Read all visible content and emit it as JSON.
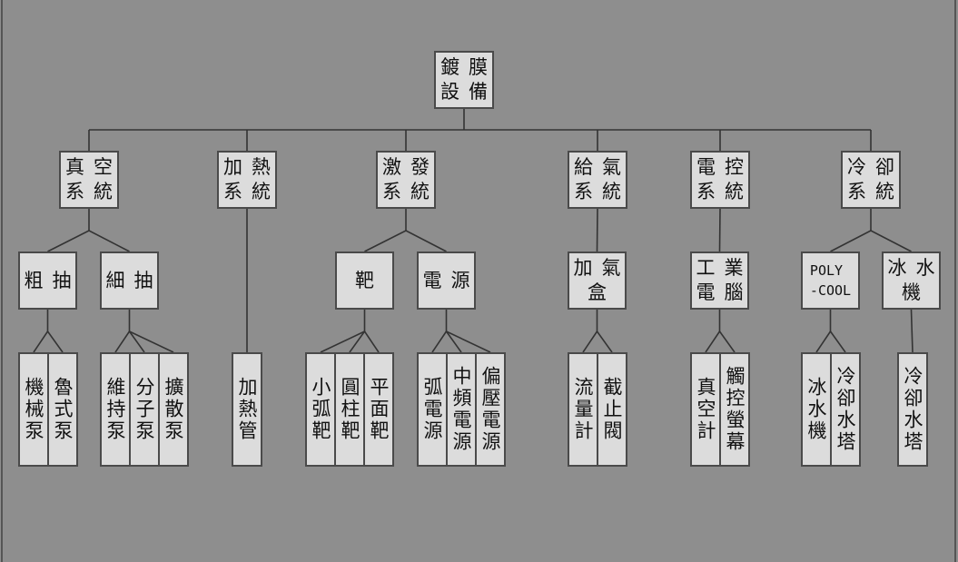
{
  "diagram": {
    "type": "tree",
    "root": {
      "label": "鍍膜設備",
      "rows": [
        "鍍膜",
        "設備"
      ],
      "children": [
        {
          "label": "真空系統",
          "rows": [
            "真空",
            "系統"
          ],
          "children": [
            {
              "label": "粗抽",
              "rows": [
                "粗抽"
              ],
              "leaves": [
                "機械泵",
                "魯式泵"
              ]
            },
            {
              "label": "細抽",
              "rows": [
                "細抽"
              ],
              "leaves": [
                "維持泵",
                "分子泵",
                "擴散泵"
              ]
            }
          ]
        },
        {
          "label": "加熱系統",
          "rows": [
            "加熱",
            "系統"
          ],
          "leaves": [
            "加熱管"
          ]
        },
        {
          "label": "激發系統",
          "rows": [
            "激發",
            "系統"
          ],
          "children": [
            {
              "label": "靶",
              "rows": [
                "靶"
              ],
              "leaves": [
                "小弧靶",
                "圓柱靶",
                "平面靶"
              ]
            },
            {
              "label": "電源",
              "rows": [
                "電源"
              ],
              "leaves": [
                "弧電源",
                "中頻電源",
                "偏壓電源"
              ]
            }
          ]
        },
        {
          "label": "給氣系統",
          "rows": [
            "給氣",
            "系統"
          ],
          "children": [
            {
              "label": "加氣盒",
              "rows": [
                "加氣",
                "盒"
              ],
              "leaves": [
                "流量計",
                "截止閥"
              ]
            }
          ]
        },
        {
          "label": "電控系統",
          "rows": [
            "電控",
            "系統"
          ],
          "children": [
            {
              "label": "工業電腦",
              "rows": [
                "工業",
                "電腦"
              ],
              "leaves": [
                "真空計",
                "觸控螢幕"
              ]
            }
          ]
        },
        {
          "label": "冷卻系統",
          "rows": [
            "冷卻",
            "系統"
          ],
          "children": [
            {
              "label": "POLY-COOL",
              "rows": [
                "POLY",
                "-COOL"
              ],
              "latin": true,
              "leaves": [
                "冰水機",
                "冷卻水塔"
              ]
            },
            {
              "label": "冰水機",
              "rows": [
                "冰水",
                "機"
              ],
              "leaves": [
                "冷卻水塔"
              ]
            }
          ]
        }
      ]
    }
  },
  "colors": {
    "background": "#8e8e8e",
    "node_fill": "#dcdcdc",
    "node_border": "#4a4a4a",
    "text": "#111111",
    "line": "#333333"
  }
}
